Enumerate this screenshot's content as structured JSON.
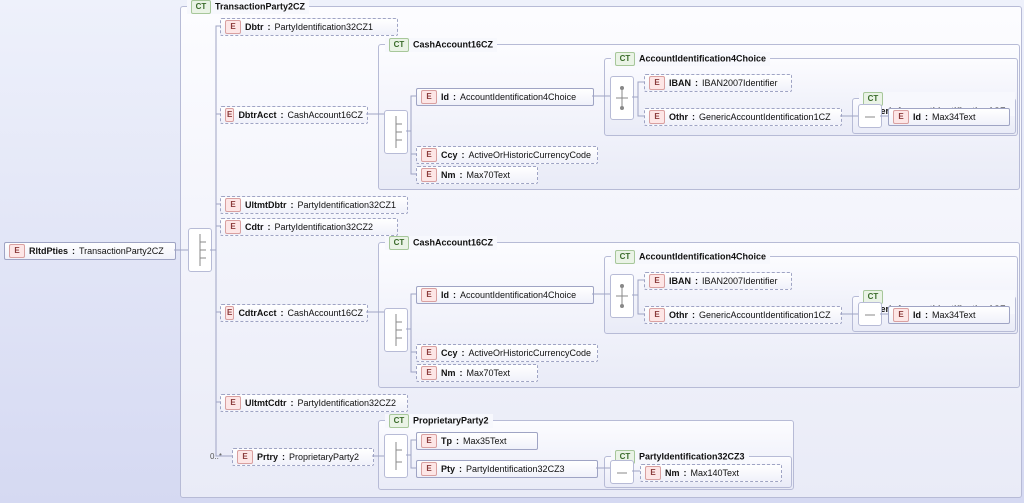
{
  "root": {
    "name": "RltdPties",
    "type": "TransactionParty2CZ"
  },
  "ct": {
    "tp2cz": "TransactionParty2CZ",
    "ca16cz_a": "CashAccount16CZ",
    "ca16cz_b": "CashAccount16CZ",
    "ai4c_a": "AccountIdentification4Choice",
    "ai4c_b": "AccountIdentification4Choice",
    "gai1cz_a": "GenericAccountIdentification1CZ",
    "gai1cz_b": "GenericAccountIdentification1CZ",
    "pp2": "ProprietaryParty2",
    "pi32cz3": "PartyIdentification32CZ3"
  },
  "elems": {
    "dbtr": {
      "name": "Dbtr",
      "type": "PartyIdentification32CZ1"
    },
    "dbtrAcct": {
      "name": "DbtrAcct",
      "type": "CashAccount16CZ"
    },
    "ultmtDbtr": {
      "name": "UltmtDbtr",
      "type": "PartyIdentification32CZ1"
    },
    "cdtr": {
      "name": "Cdtr",
      "type": "PartyIdentification32CZ2"
    },
    "cdtrAcct": {
      "name": "CdtrAcct",
      "type": "CashAccount16CZ"
    },
    "ultmtCdtr": {
      "name": "UltmtCdtr",
      "type": "PartyIdentification32CZ2"
    },
    "prtry": {
      "name": "Prtry",
      "type": "ProprietaryParty2"
    },
    "id_a": {
      "name": "Id",
      "type": "AccountIdentification4Choice"
    },
    "ccy_a": {
      "name": "Ccy",
      "type": "ActiveOrHistoricCurrencyCode"
    },
    "nm_a": {
      "name": "Nm",
      "type": "Max70Text"
    },
    "id_b": {
      "name": "Id",
      "type": "AccountIdentification4Choice"
    },
    "ccy_b": {
      "name": "Ccy",
      "type": "ActiveOrHistoricCurrencyCode"
    },
    "nm_b": {
      "name": "Nm",
      "type": "Max70Text"
    },
    "iban_a": {
      "name": "IBAN",
      "type": "IBAN2007Identifier"
    },
    "othr_a": {
      "name": "Othr",
      "type": "GenericAccountIdentification1CZ"
    },
    "iban_b": {
      "name": "IBAN",
      "type": "IBAN2007Identifier"
    },
    "othr_b": {
      "name": "Othr",
      "type": "GenericAccountIdentification1CZ"
    },
    "gid_a": {
      "name": "Id",
      "type": "Max34Text"
    },
    "gid_b": {
      "name": "Id",
      "type": "Max34Text"
    },
    "tp": {
      "name": "Tp",
      "type": "Max35Text"
    },
    "pty": {
      "name": "Pty",
      "type": "PartyIdentification32CZ3"
    },
    "pnm": {
      "name": "Nm",
      "type": "Max140Text"
    }
  },
  "mult": {
    "prtry": "0..*"
  }
}
